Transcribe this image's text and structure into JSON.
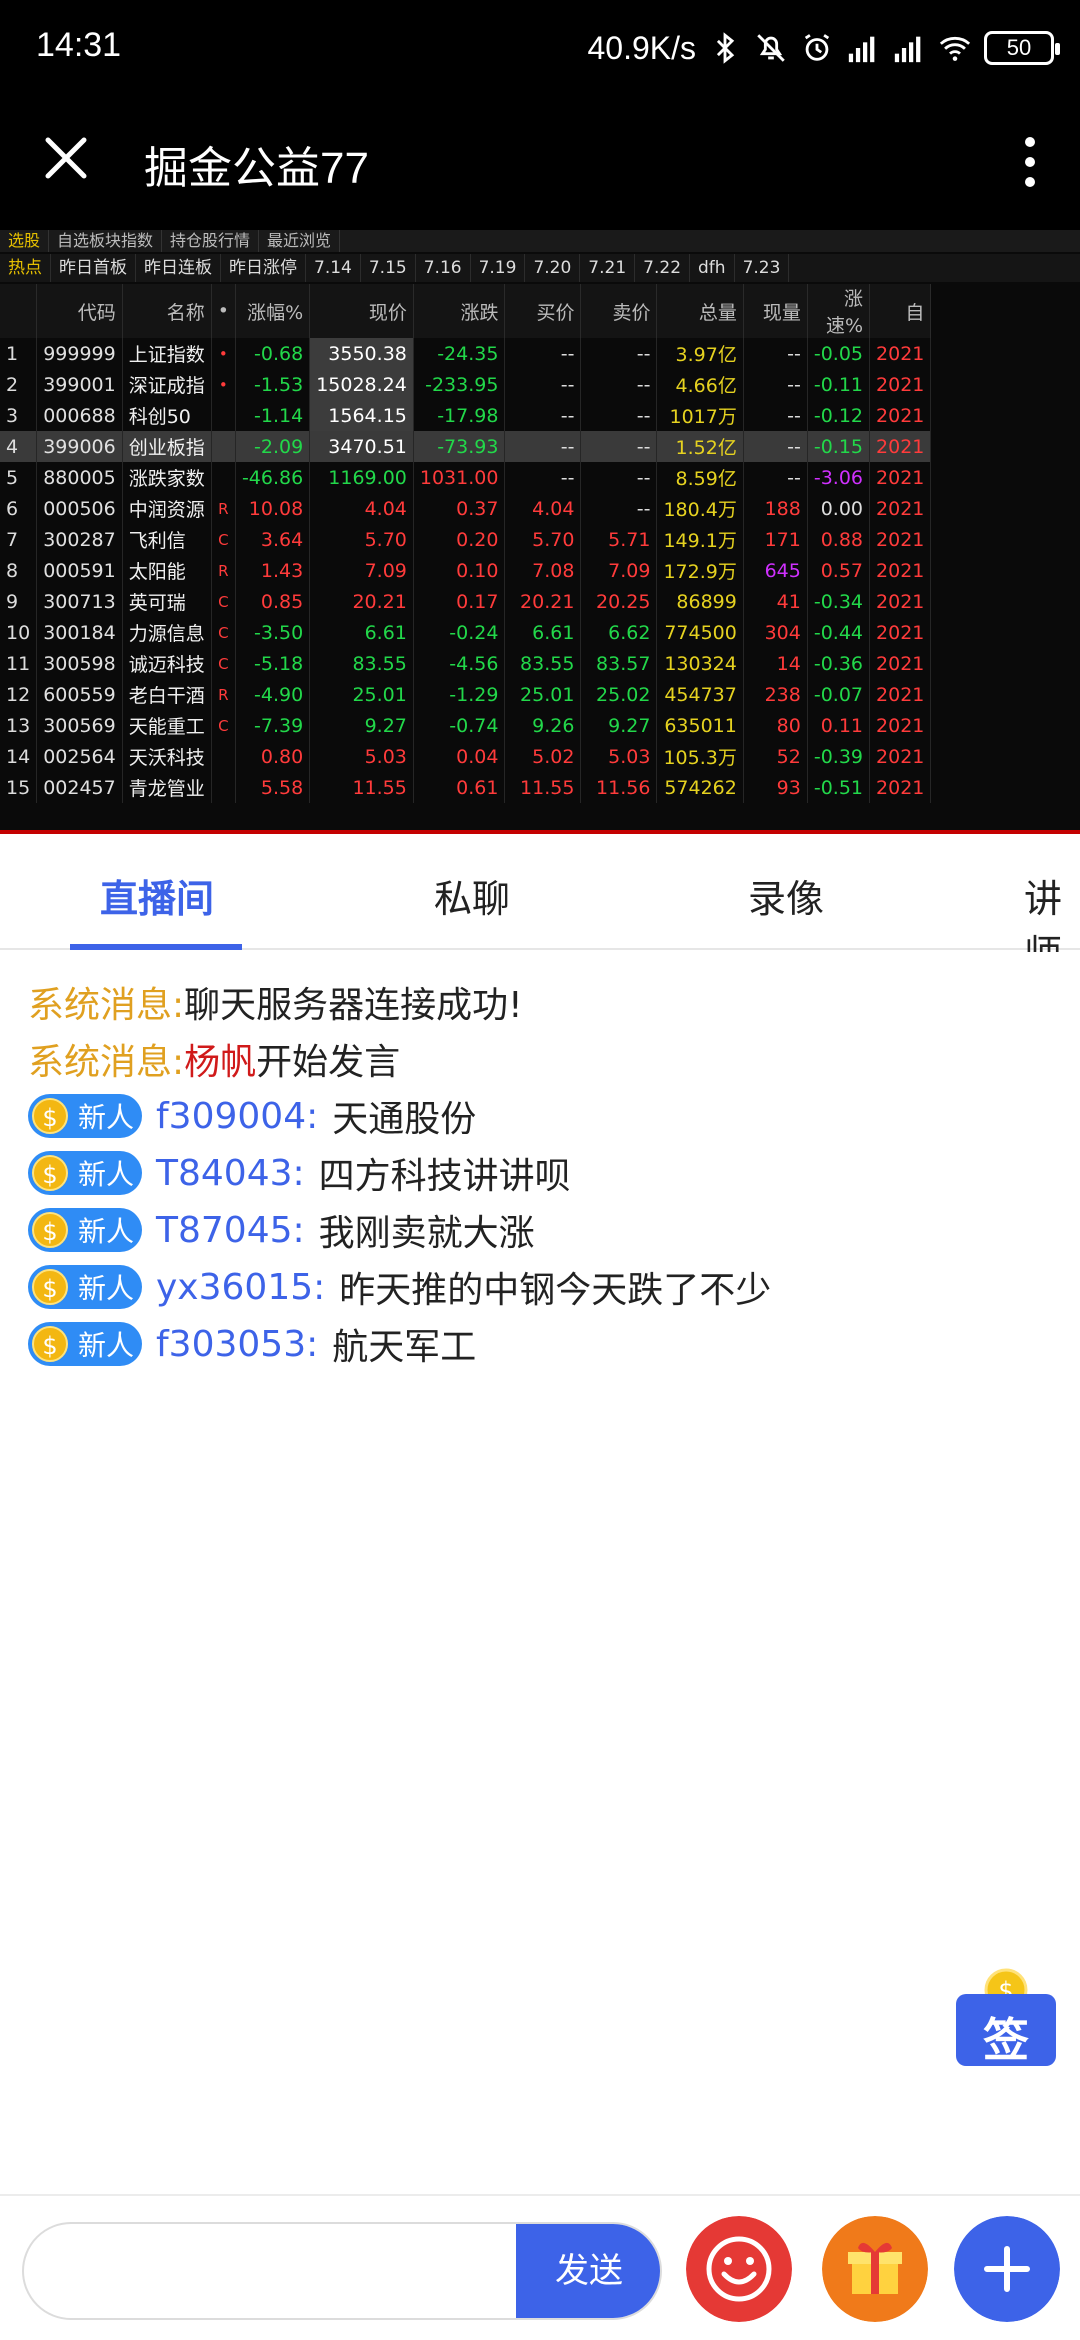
{
  "status_bar": {
    "time": "14:31",
    "net_speed": "40.9K/s",
    "battery": "50"
  },
  "app_bar": {
    "title": "掘金公益77"
  },
  "stock_panel": {
    "top_tabs": [
      "选股",
      "自选板块指数",
      "持仓股行情",
      "最近浏览"
    ],
    "date_tabs": [
      "热点",
      "昨日首板",
      "昨日连板",
      "昨日涨停",
      "7.14",
      "7.15",
      "7.16",
      "7.19",
      "7.20",
      "7.21",
      "7.22",
      "dfh",
      "7.23"
    ],
    "columns": [
      "",
      "代码",
      "名称",
      "•",
      "涨幅%",
      "现价",
      "涨跌",
      "买价",
      "卖价",
      "总量",
      "现量",
      "涨速%",
      "自"
    ],
    "rows": [
      {
        "idx": "1",
        "code": "999999",
        "name": "上证指数",
        "flag": "•",
        "pct": "-0.68",
        "price": "3550.38",
        "chg": "-24.35",
        "bid": "--",
        "ask": "--",
        "vol": "3.97亿",
        "cur": "--",
        "speed": "-0.05",
        "date": "2021"
      },
      {
        "idx": "2",
        "code": "399001",
        "name": "深证成指",
        "flag": "•",
        "pct": "-1.53",
        "price": "15028.24",
        "chg": "-233.95",
        "bid": "--",
        "ask": "--",
        "vol": "4.66亿",
        "cur": "--",
        "speed": "-0.11",
        "date": "2021"
      },
      {
        "idx": "3",
        "code": "000688",
        "name": "科创50",
        "flag": "",
        "pct": "-1.14",
        "price": "1564.15",
        "chg": "-17.98",
        "bid": "--",
        "ask": "--",
        "vol": "1017万",
        "cur": "--",
        "speed": "-0.12",
        "date": "2021"
      },
      {
        "idx": "4",
        "code": "399006",
        "name": "创业板指",
        "flag": "",
        "pct": "-2.09",
        "price": "3470.51",
        "chg": "-73.93",
        "bid": "--",
        "ask": "--",
        "vol": "1.52亿",
        "cur": "--",
        "speed": "-0.15",
        "date": "2021"
      },
      {
        "idx": "5",
        "code": "880005",
        "name": "涨跌家数",
        "flag": "",
        "pct": "-46.86",
        "price": "1169.00",
        "chg": "1031.00",
        "bid": "--",
        "ask": "--",
        "vol": "8.59亿",
        "cur": "--",
        "speed": "-3.06",
        "date": "2021"
      },
      {
        "idx": "6",
        "code": "000506",
        "name": "中润资源",
        "flag": "R",
        "pct": "10.08",
        "price": "4.04",
        "chg": "0.37",
        "bid": "4.04",
        "ask": "--",
        "vol": "180.4万",
        "cur": "188",
        "speed": "0.00",
        "date": "2021"
      },
      {
        "idx": "7",
        "code": "300287",
        "name": "飞利信",
        "flag": "C",
        "pct": "3.64",
        "price": "5.70",
        "chg": "0.20",
        "bid": "5.70",
        "ask": "5.71",
        "vol": "149.1万",
        "cur": "171",
        "speed": "0.88",
        "date": "2021"
      },
      {
        "idx": "8",
        "code": "000591",
        "name": "太阳能",
        "flag": "R",
        "pct": "1.43",
        "price": "7.09",
        "chg": "0.10",
        "bid": "7.08",
        "ask": "7.09",
        "vol": "172.9万",
        "cur": "645",
        "speed": "0.57",
        "date": "2021"
      },
      {
        "idx": "9",
        "code": "300713",
        "name": "英可瑞",
        "flag": "C",
        "pct": "0.85",
        "price": "20.21",
        "chg": "0.17",
        "bid": "20.21",
        "ask": "20.25",
        "vol": "86899",
        "cur": "41",
        "speed": "-0.34",
        "date": "2021"
      },
      {
        "idx": "10",
        "code": "300184",
        "name": "力源信息",
        "flag": "C",
        "pct": "-3.50",
        "price": "6.61",
        "chg": "-0.24",
        "bid": "6.61",
        "ask": "6.62",
        "vol": "774500",
        "cur": "304",
        "speed": "-0.44",
        "date": "2021"
      },
      {
        "idx": "11",
        "code": "300598",
        "name": "诚迈科技",
        "flag": "C",
        "pct": "-5.18",
        "price": "83.55",
        "chg": "-4.56",
        "bid": "83.55",
        "ask": "83.57",
        "vol": "130324",
        "cur": "14",
        "speed": "-0.36",
        "date": "2021"
      },
      {
        "idx": "12",
        "code": "600559",
        "name": "老白干酒",
        "flag": "R",
        "pct": "-4.90",
        "price": "25.01",
        "chg": "-1.29",
        "bid": "25.01",
        "ask": "25.02",
        "vol": "454737",
        "cur": "238",
        "speed": "-0.07",
        "date": "2021"
      },
      {
        "idx": "13",
        "code": "300569",
        "name": "天能重工",
        "flag": "C",
        "pct": "-7.39",
        "price": "9.27",
        "chg": "-0.74",
        "bid": "9.26",
        "ask": "9.27",
        "vol": "635011",
        "cur": "80",
        "speed": "0.11",
        "date": "2021"
      },
      {
        "idx": "14",
        "code": "002564",
        "name": "天沃科技",
        "flag": "",
        "pct": "0.80",
        "price": "5.03",
        "chg": "0.04",
        "bid": "5.02",
        "ask": "5.03",
        "vol": "105.3万",
        "cur": "52",
        "speed": "-0.39",
        "date": "2021"
      },
      {
        "idx": "15",
        "code": "002457",
        "name": "青龙管业",
        "flag": "",
        "pct": "5.58",
        "price": "11.55",
        "chg": "0.61",
        "bid": "11.55",
        "ask": "11.56",
        "vol": "574262",
        "cur": "93",
        "speed": "-0.51",
        "date": "2021"
      }
    ]
  },
  "tabs": [
    "直播间",
    "私聊",
    "录像",
    "讲师"
  ],
  "chat": {
    "system_label": "系统消息:",
    "system_messages": [
      {
        "text": "聊天服务器连接成功!",
        "name": ""
      },
      {
        "text": "开始发言",
        "name": "杨帆"
      }
    ],
    "badge_label": "新人",
    "messages": [
      {
        "user": "f309004",
        "text": "天通股份"
      },
      {
        "user": "T84043",
        "text": "四方科技讲讲呗"
      },
      {
        "user": "T87045",
        "text": "我刚卖就大涨"
      },
      {
        "user": "yx36015",
        "text": "昨天推的中钢今天跌了不少"
      },
      {
        "user": "f303053",
        "text": "航天军工"
      }
    ]
  },
  "signin": {
    "label": "签"
  },
  "bottom_bar": {
    "input_placeholder": "",
    "send_label": "发送"
  },
  "colors": {
    "accent": "#3d63e8",
    "system": "#e0a020",
    "emoji": "#e53935",
    "gift": "#f07a1a"
  }
}
